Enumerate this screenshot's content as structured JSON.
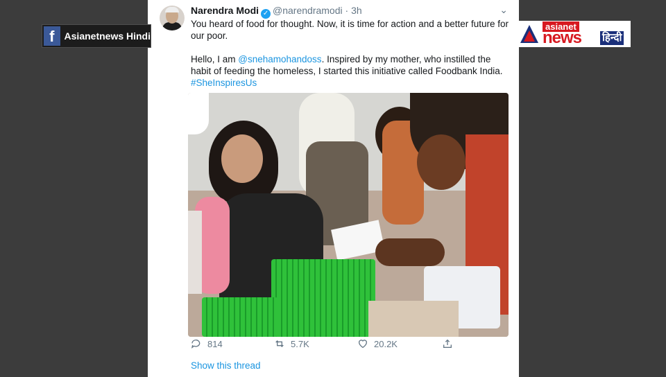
{
  "overlay": {
    "facebook_logo": "f",
    "facebook_label": "Asianetnews Hindi",
    "brand_asianet": "asianet",
    "brand_news": "news",
    "brand_hindi": "हिन्दी"
  },
  "tweet": {
    "author_name": "Narendra Modi",
    "verified_icon": "check-badge-icon",
    "handle": "@narendramodi",
    "separator": "·",
    "time": "3h",
    "caret": "⌄",
    "line1": "You heard of food for thought. Now, it is time for action and a better future for our poor.",
    "line2_pre": "Hello, I am ",
    "mention": "@snehamohandoss",
    "line2_post": ". Inspired by my mother, who instilled the habit of feeding the homeless,  I started this initiative called Foodbank India.",
    "hashtag": "#SheInspiresUs",
    "replies": "814",
    "retweets": "5.7K",
    "likes": "20.2K",
    "show_thread": "Show this thread"
  },
  "colors": {
    "link": "#1b95e0",
    "muted": "#657786",
    "verified": "#1da1f2",
    "asianet_red": "#d71920",
    "hindi_blue": "#1a2f7a",
    "facebook_blue": "#3b5998"
  }
}
